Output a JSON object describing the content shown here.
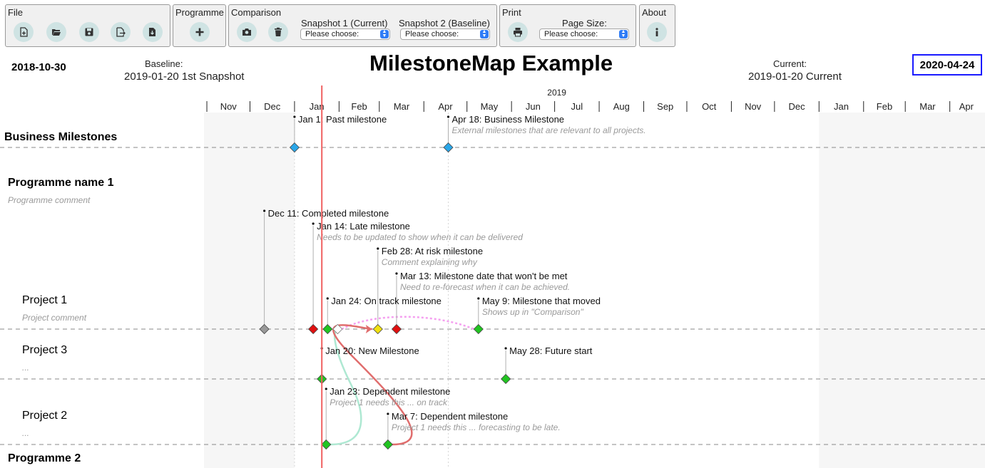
{
  "toolbar": {
    "file": {
      "title": "File",
      "buttons": [
        {
          "name": "new-file-button",
          "icon": "file-plus-icon"
        },
        {
          "name": "open-file-button",
          "icon": "folder-open-icon"
        },
        {
          "name": "save-file-button",
          "icon": "floppy-disk-icon"
        },
        {
          "name": "export-file-button",
          "icon": "file-export-icon"
        },
        {
          "name": "import-file-button",
          "icon": "file-import-icon"
        }
      ]
    },
    "programme": {
      "title": "Programme",
      "add_icon": "plus-icon"
    },
    "comparison": {
      "title": "Comparison",
      "snapshot_icon": "camera-icon",
      "delete_icon": "trash-icon",
      "snapshot1_label": "Snapshot 1 (Current)",
      "snapshot2_label": "Snapshot 2 (Baseline)",
      "snapshot1_value": "Please choose:",
      "snapshot2_value": "Please choose:"
    },
    "print": {
      "title": "Print",
      "print_icon": "printer-icon",
      "page_size_label": "Page Size:",
      "page_size_value": "Please choose:"
    },
    "about": {
      "title": "About",
      "info_icon": "info-icon"
    }
  },
  "header": {
    "start_date": "2018-10-30",
    "baseline_label": "Baseline:",
    "baseline_value": "2019-01-20 1st Snapshot",
    "title": "MilestoneMap Example",
    "current_label": "Current:",
    "current_value": "2019-01-20 Current",
    "end_date": "2020-04-24"
  },
  "timeline": {
    "year_label": "2019",
    "months": [
      "Nov",
      "Dec",
      "Jan",
      "Feb",
      "Mar",
      "Apr",
      "May",
      "Jun",
      "Jul",
      "Aug",
      "Sep",
      "Oct",
      "Nov",
      "Dec",
      "Jan",
      "Feb",
      "Mar",
      "Apr"
    ]
  },
  "rows": {
    "business": {
      "title": "Business Milestones"
    },
    "programme1": {
      "title": "Programme name 1",
      "comment": "Programme comment"
    },
    "project1": {
      "title": "Project 1",
      "comment": "Project comment"
    },
    "project3": {
      "title": "Project 3",
      "comment": "..."
    },
    "project2": {
      "title": "Project 2",
      "comment": "..."
    },
    "programme2": {
      "title": "Programme 2"
    }
  },
  "milestones": [
    {
      "id": "m_bm1",
      "label": "Jan 1: Past milestone",
      "comment": "",
      "color": "#2aa6e8",
      "row": "business",
      "date": "2019-01-01"
    },
    {
      "id": "m_bm2",
      "label": "Apr 18: Business Milestone",
      "comment": "External milestones that are relevant to all projects.",
      "color": "#2aa6e8",
      "row": "business",
      "date": "2019-04-18"
    },
    {
      "id": "m_p1a",
      "label": "Dec 11: Completed milestone",
      "comment": "",
      "color": "#999999",
      "row": "project1",
      "date": "2018-12-11"
    },
    {
      "id": "m_p1b",
      "label": "Jan 14: Late milestone",
      "comment": "Needs to be updated to show when it can be delivered",
      "color": "#e01010",
      "row": "project1",
      "date": "2019-01-14"
    },
    {
      "id": "m_p1c",
      "label": "Feb 28: At risk milestone",
      "comment": "Comment explaining why",
      "color": "#f0e010",
      "row": "project1",
      "date": "2019-02-28"
    },
    {
      "id": "m_p1d",
      "label": "Mar 13: Milestone date that won't be met",
      "comment": "Need to re-forecast when it can be achieved.",
      "color": "#e01010",
      "row": "project1",
      "date": "2019-03-13"
    },
    {
      "id": "m_p1e",
      "label": "Jan 24: On track milestone",
      "comment": "",
      "color": "#22c422",
      "row": "project1",
      "date": "2019-01-24"
    },
    {
      "id": "m_p1f",
      "label": "May 9: Milestone that moved",
      "comment": "Shows up in \"Comparison\"",
      "color": "#22c422",
      "row": "project1",
      "date": "2019-05-09"
    },
    {
      "id": "m_p3a",
      "label": "Jan 20: New Milestone",
      "comment": "",
      "color": "#22c422",
      "row": "project3",
      "date": "2019-01-20"
    },
    {
      "id": "m_p3b",
      "label": "May 28: Future start",
      "comment": "",
      "color": "#22c422",
      "row": "project3",
      "date": "2019-05-28"
    },
    {
      "id": "m_p2a",
      "label": "Jan 23: Dependent milestone",
      "comment": "Project 1 needs this ... on track",
      "color": "#22c422",
      "row": "project2",
      "date": "2019-01-23"
    },
    {
      "id": "m_p2b",
      "label": "Mar 7: Dependent milestone",
      "comment": "Project 1 needs this ... forecasting to be late.",
      "color": "#22c422",
      "row": "project2",
      "date": "2019-03-07"
    }
  ],
  "moved_from_date": "2019-01-31",
  "moved_from_color": "#ffffff",
  "today_date": "2019-01-20",
  "colors": {
    "today_line": "#f06060",
    "row_divider": "#888888",
    "shade": "#f6f6f6",
    "dep_green": "#aee8d2",
    "dep_red": "#e06d6d",
    "moved_pink": "#f5a0f0",
    "accent_blue": "#1a1aff"
  }
}
